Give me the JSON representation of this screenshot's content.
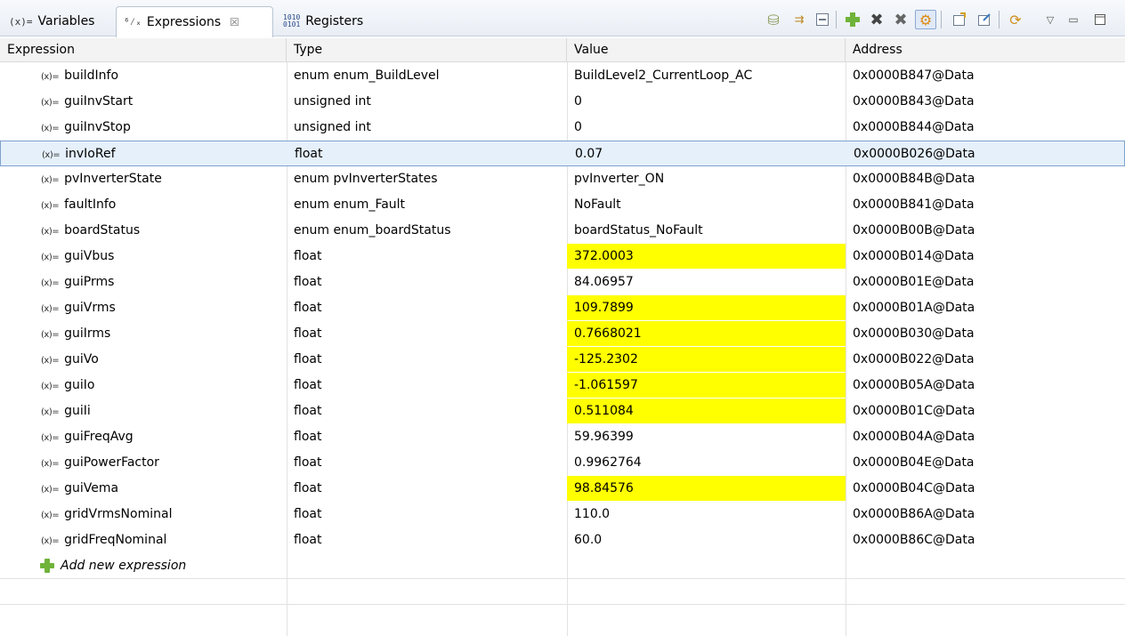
{
  "tabs": [
    {
      "icon": "(x)=",
      "label": "Variables"
    },
    {
      "icon": "⁶⁄ₓ",
      "label": "Expressions",
      "close": "☒"
    },
    {
      "icon": "1010\n0101",
      "label": "Registers"
    }
  ],
  "toolbar": {
    "icons": [
      "show-type-names-icon",
      "collapse-all-icon",
      "collapse-icon",
      "add-expression-icon",
      "remove-icon",
      "remove-all-icon",
      "continuous-refresh-icon",
      "import-icon",
      "export-icon",
      "refresh-icon",
      "view-menu-icon",
      "minimize-icon",
      "maximize-icon"
    ]
  },
  "columns": [
    "Expression",
    "Type",
    "Value",
    "Address"
  ],
  "var_icon": "(x)=",
  "rows": [
    {
      "name": "buildInfo",
      "type": "enum enum_BuildLevel",
      "value": "BuildLevel2_CurrentLoop_AC",
      "address": "0x0000B847@Data",
      "changed": false
    },
    {
      "name": "guiInvStart",
      "type": "unsigned int",
      "value": "0",
      "address": "0x0000B843@Data",
      "changed": false
    },
    {
      "name": "guiInvStop",
      "type": "unsigned int",
      "value": "0",
      "address": "0x0000B844@Data",
      "changed": false
    },
    {
      "name": "invIoRef",
      "type": "float",
      "value": "0.07",
      "address": "0x0000B026@Data",
      "changed": false,
      "selected": true
    },
    {
      "name": "pvInverterState",
      "type": "enum pvInverterStates",
      "value": "pvInverter_ON",
      "address": "0x0000B84B@Data",
      "changed": false
    },
    {
      "name": "faultInfo",
      "type": "enum enum_Fault",
      "value": "NoFault",
      "address": "0x0000B841@Data",
      "changed": false
    },
    {
      "name": "boardStatus",
      "type": "enum enum_boardStatus",
      "value": "boardStatus_NoFault",
      "address": "0x0000B00B@Data",
      "changed": false
    },
    {
      "name": "guiVbus",
      "type": "float",
      "value": "372.0003",
      "address": "0x0000B014@Data",
      "changed": true
    },
    {
      "name": "guiPrms",
      "type": "float",
      "value": "84.06957",
      "address": "0x0000B01E@Data",
      "changed": false
    },
    {
      "name": "guiVrms",
      "type": "float",
      "value": "109.7899",
      "address": "0x0000B01A@Data",
      "changed": true
    },
    {
      "name": "guiIrms",
      "type": "float",
      "value": "0.7668021",
      "address": "0x0000B030@Data",
      "changed": true
    },
    {
      "name": "guiVo",
      "type": "float",
      "value": "-125.2302",
      "address": "0x0000B022@Data",
      "changed": true
    },
    {
      "name": "guiIo",
      "type": "float",
      "value": "-1.061597",
      "address": "0x0000B05A@Data",
      "changed": true
    },
    {
      "name": "guiIi",
      "type": "float",
      "value": "0.511084",
      "address": "0x0000B01C@Data",
      "changed": true
    },
    {
      "name": "guiFreqAvg",
      "type": "float",
      "value": "59.96399",
      "address": "0x0000B04A@Data",
      "changed": false
    },
    {
      "name": "guiPowerFactor",
      "type": "float",
      "value": "0.9962764",
      "address": "0x0000B04E@Data",
      "changed": false
    },
    {
      "name": "guiVema",
      "type": "float",
      "value": "98.84576",
      "address": "0x0000B04C@Data",
      "changed": true
    },
    {
      "name": "gridVrmsNominal",
      "type": "float",
      "value": "110.0",
      "address": "0x0000B86A@Data",
      "changed": false
    },
    {
      "name": "gridFreqNominal",
      "type": "float",
      "value": "60.0",
      "address": "0x0000B86C@Data",
      "changed": false
    }
  ],
  "add_new": "Add new expression",
  "colors": {
    "changed_highlight": "#ffff00",
    "selection": "#e5f0fb",
    "add_icon": "#6fb33a"
  }
}
